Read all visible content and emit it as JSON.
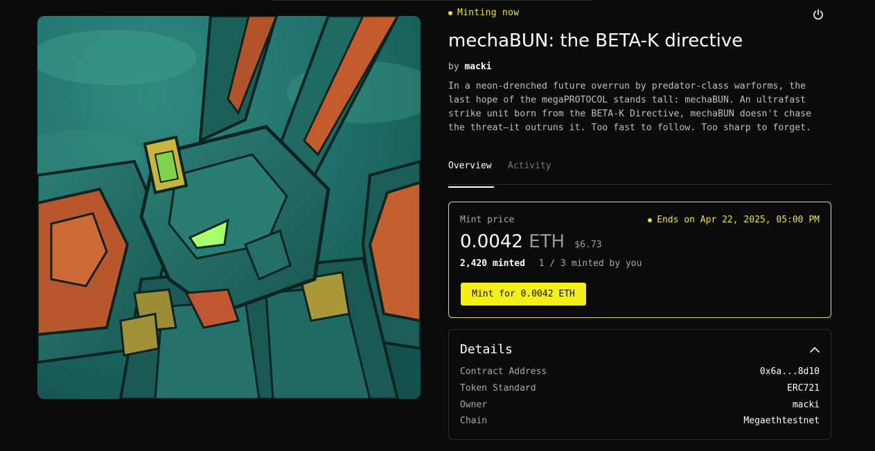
{
  "status": "Minting now",
  "title": "mechaBUN: the BETA-K directive",
  "byline": {
    "prefix": "by",
    "author": "macki"
  },
  "description": "In a neon-drenched future overrun by predator-class warforms, the last hope of the megaPROTOCOL stands tall: mechaBUN. An ultrafast strike unit born from the BETA-K Directive, mechaBUN doesn't chase the threat—it outruns it. Too fast to follow. Too sharp to forget.",
  "tabs": [
    {
      "label": "Overview",
      "active": true
    },
    {
      "label": "Activity",
      "active": false
    }
  ],
  "mint": {
    "label": "Mint price",
    "ends": "Ends on Apr 22, 2025, 05:00 PM",
    "price": "0.0042",
    "unit": "ETH",
    "usd": "$6.73",
    "minted": "2,420 minted",
    "by_you": "1 / 3 minted by you",
    "button": "Mint for 0.0042 ETH"
  },
  "details": {
    "title": "Details",
    "rows": [
      {
        "key": "Contract Address",
        "value": "0x6a...8d10"
      },
      {
        "key": "Token Standard",
        "value": "ERC721"
      },
      {
        "key": "Owner",
        "value": "macki"
      },
      {
        "key": "Chain",
        "value": "Megaethtestnet"
      }
    ]
  },
  "icons": {
    "power": "power-icon",
    "collapse": "chevron-up-icon",
    "status_dot": "dot-icon"
  },
  "colors": {
    "accent": "#f2e52a",
    "background": "#0b0b0c",
    "button": "#f4ee1a",
    "border": "#2a2a2a"
  }
}
